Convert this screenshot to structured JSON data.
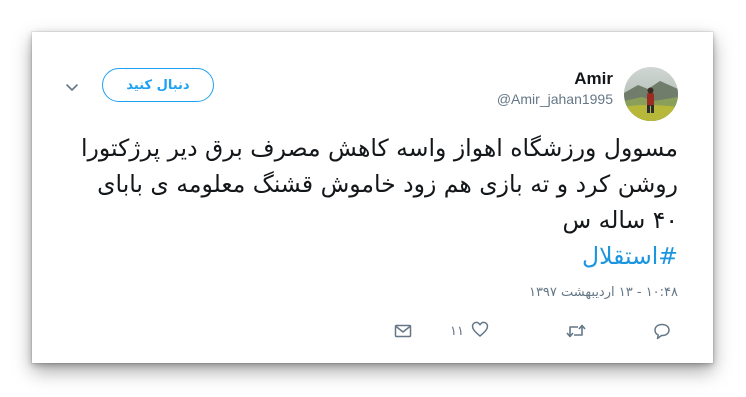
{
  "user": {
    "name": "Amir",
    "handle": "@Amir_jahan1995"
  },
  "follow_button": {
    "label": "دنبال کنید"
  },
  "tweet": {
    "text": "مسوول ورزشگاه اهواز واسه کاهش مصرف برق دیر پرژکتورا روشن کرد و ته بازی هم زود خاموش قشنگ معلومه ی بابای ۴۰ ساله س",
    "hashtag": "#استقلال",
    "timestamp": "۱۰:۴۸ - ۱۳ اردیبهشت ۱۳۹۷"
  },
  "actions": {
    "likes_count": "۱۱"
  },
  "icons": {
    "more": "chevron-down-icon",
    "reply": "reply-icon",
    "retweet": "retweet-icon",
    "like": "heart-icon",
    "dm": "envelope-icon"
  },
  "colors": {
    "accent": "#1da1f2",
    "hashtag": "#1b95e0",
    "text": "#14171a",
    "muted": "#657786"
  }
}
